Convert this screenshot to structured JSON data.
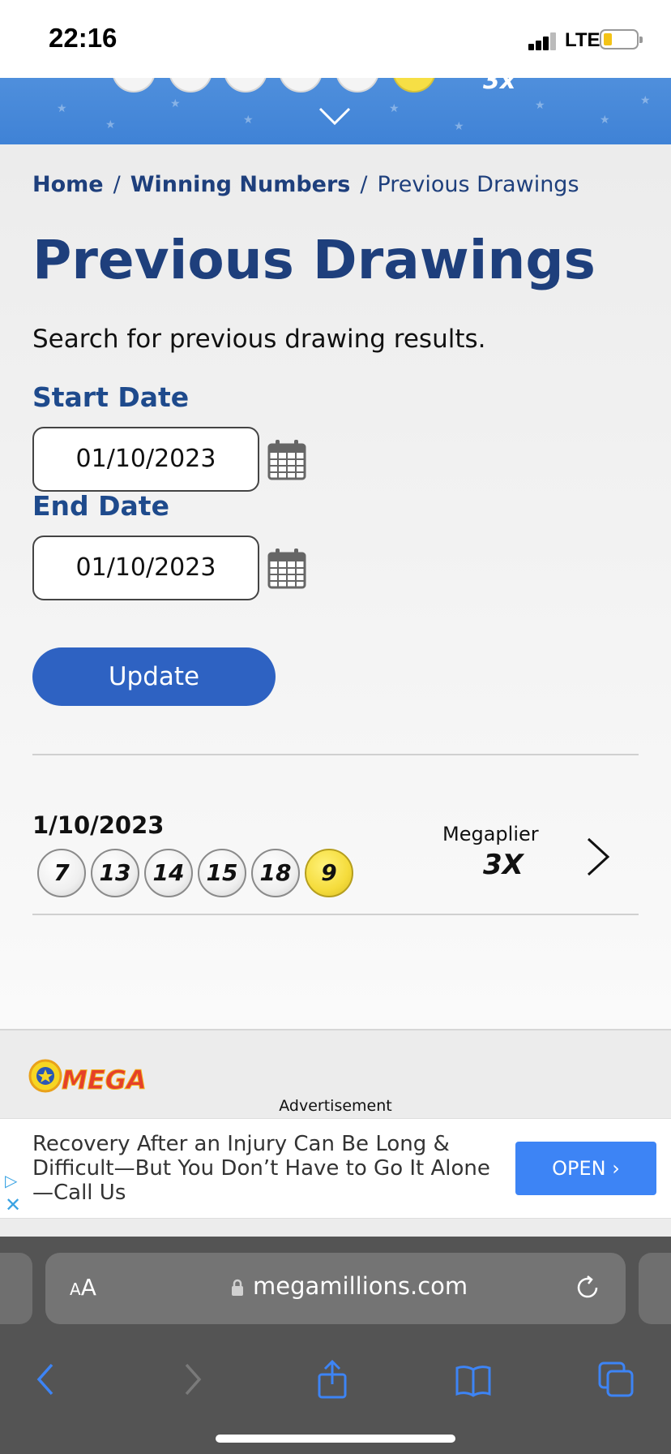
{
  "status_bar": {
    "time": "22:16",
    "network": "LTE"
  },
  "hero": {
    "multiplier": "3x"
  },
  "breadcrumb": [
    {
      "label": "Home"
    },
    {
      "label": "Winning Numbers"
    },
    {
      "label": "Previous Drawings"
    }
  ],
  "breadcrumb_separator": "/",
  "page": {
    "title": "Previous Drawings",
    "intro": "Search for previous drawing results."
  },
  "form": {
    "start_label": "Start Date",
    "start_value": "01/10/2023",
    "end_label": "End Date",
    "end_value": "01/10/2023",
    "update_label": "Update"
  },
  "result": {
    "date": "1/10/2023",
    "numbers": [
      "7",
      "13",
      "14",
      "15",
      "18"
    ],
    "megaball": "9",
    "megaplier_label": "Megaplier",
    "megaplier_value": "3X"
  },
  "footer": {
    "logo_text": "MEGA",
    "ad_label": "Advertisement",
    "ad_text": "Recovery After an Injury Can Be Long & Difficult—But You Don’t Have to Go It Alone—Call Us",
    "ad_button": "OPEN ›"
  },
  "browser": {
    "aa_small": "A",
    "aa_large": "A",
    "url": "megamillions.com"
  },
  "colors": {
    "brand_blue": "#1e3f7c",
    "button_blue": "#2e62c2",
    "megaball_yellow": "#f5dc3c",
    "ad_button_blue": "#3d84f5"
  },
  "icons": [
    "calendar-icon",
    "chevron-right-icon",
    "chevron-down-icon",
    "lock-icon",
    "reload-icon",
    "back-icon",
    "forward-icon",
    "share-icon",
    "bookmarks-icon",
    "tabs-icon",
    "ad-choices-icon",
    "close-icon"
  ]
}
